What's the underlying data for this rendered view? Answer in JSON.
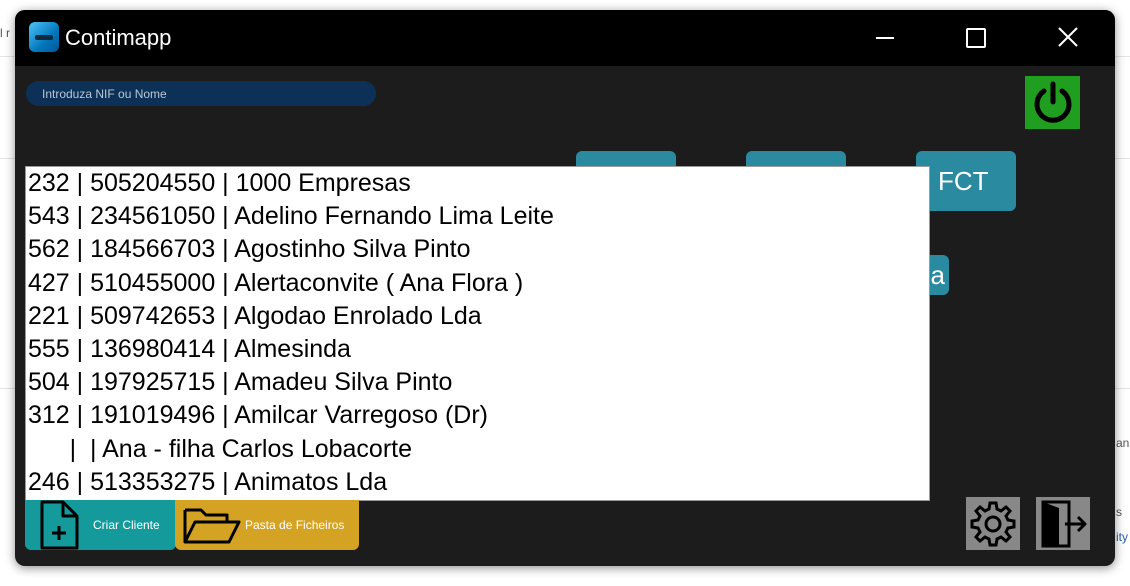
{
  "window": {
    "title": "Contimapp",
    "minimize_icon": "minimize-icon",
    "maximize_icon": "maximize-icon",
    "close_icon": "close-icon"
  },
  "search": {
    "placeholder": "Introduza NIF ou Nome",
    "value": ""
  },
  "tiles": {
    "fct_label": "FCT",
    "partial_label": "a"
  },
  "dropdown": {
    "items": [
      "232 | 505204550 | 1000 Empresas",
      "543 | 234561050 | Adelino Fernando Lima Leite",
      "562 | 184566703 | Agostinho Silva Pinto",
      "427 | 510455000 | Alertaconvite ( Ana Flora )",
      "221 | 509742653 | Algodao Enrolado Lda",
      "555 | 136980414 | Almesinda",
      "504 | 197925715 | Amadeu Silva Pinto",
      "312 | 191019496 | Amilcar Varregoso (Dr)",
      "      |  | Ana - filha Carlos Lobacorte",
      "246 | 513353275 | Animatos Lda"
    ]
  },
  "actions": {
    "criar_cliente": "Criar Cliente",
    "pasta_ficheiros": "Pasta de Ficheiros"
  },
  "colors": {
    "power": "#1f9e1f",
    "tile": "#2a8aa0",
    "criar": "#159a9c",
    "pasta": "#d5a323",
    "search_bg": "#0d3156"
  },
  "background_fragments": {
    "top_left": "l r",
    "right_1": "an",
    "right_2": "s",
    "right_3": "ity"
  }
}
